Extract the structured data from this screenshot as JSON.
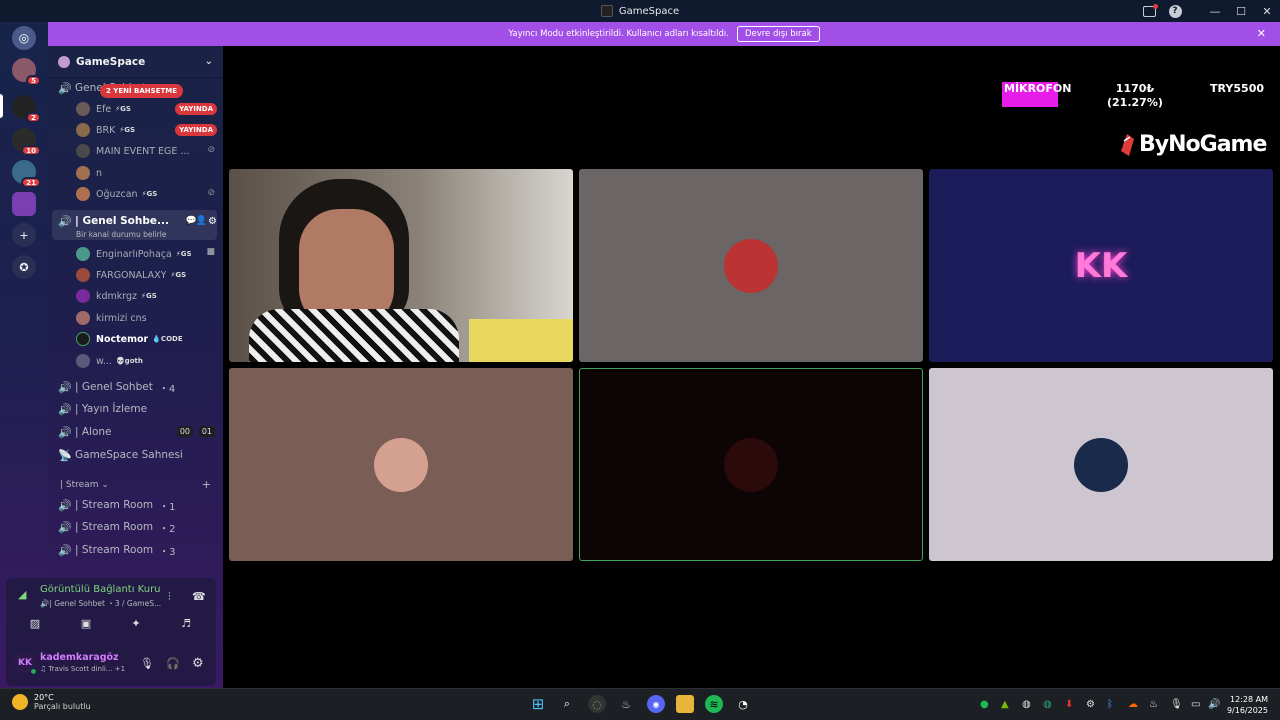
{
  "window": {
    "title": "GameSpace"
  },
  "banner": {
    "message": "Yayıncı Modu etkinleştirildi. Kullanıcı adları kısaltıldı.",
    "button": "Devre dışı bırak"
  },
  "guilds": [
    {
      "name": "guild-1",
      "badge": "5",
      "color": "#8a5a6a"
    },
    {
      "name": "guild-2",
      "badge": "2",
      "color": "#222"
    },
    {
      "name": "guild-3",
      "badge": "10",
      "color": "#2b2b2b"
    },
    {
      "name": "guild-4",
      "badge": "21",
      "color": "#3b6a8a"
    },
    {
      "name": "guild-5",
      "badge": "",
      "color": "#7a3fb0"
    }
  ],
  "server": {
    "name": "GameSpace"
  },
  "mention_pill": "2 YENİ BAHSETME",
  "channel_top": {
    "label": "Genel Sohbet",
    "count": "2"
  },
  "top_users": [
    {
      "name": "Efe",
      "tag": "⚡GS",
      "live": "YAYINDA",
      "av": "#6a5a5a"
    },
    {
      "name": "BRK",
      "tag": "⚡GS",
      "live": "YAYINDA",
      "av": "#8a6a4a"
    },
    {
      "name": "MAIN EVENT EGE ...",
      "tag": "",
      "live": "",
      "av": "#4a4a4a"
    },
    {
      "name": "n",
      "tag": "",
      "live": "",
      "av": "#a07050"
    },
    {
      "name": "Oğuzcan",
      "tag": "⚡GS",
      "live": "",
      "av": "#b07050"
    }
  ],
  "selected_channel": {
    "label": "| Genel Sohbe...",
    "status": "Bir kanal durumu belirle"
  },
  "sel_users": [
    {
      "name": "EnginarlıPohaça",
      "tag": "⚡GS",
      "av": "#4a9a8a"
    },
    {
      "name": "FARGONALAXY",
      "tag": "⚡GS",
      "av": "#9a4a3a"
    },
    {
      "name": "kdmkrgz",
      "tag": "⚡GS",
      "av": "#7a2a9a"
    },
    {
      "name": "kirmizi cns",
      "tag": "",
      "av": "#a06a6a"
    },
    {
      "name": "Noctemor",
      "tag": "💧CODE",
      "av": "#1a1a1a"
    },
    {
      "name": "w...",
      "tag": "💀goth",
      "av": "#5a5a7a"
    }
  ],
  "channels": [
    {
      "label": "| Genel Sohbet",
      "count": "4",
      "icon": "🔊"
    },
    {
      "label": "| Yayın İzleme",
      "count": "",
      "icon": "🔊"
    },
    {
      "label": "| Alone",
      "count": "",
      "icon": "🔊",
      "b1": "00",
      "b2": "01"
    },
    {
      "label": "GameSpace Sahnesi",
      "count": "",
      "icon": "📡"
    }
  ],
  "category": {
    "label": "| Stream"
  },
  "streams": [
    {
      "label": "| Stream Room",
      "count": "1"
    },
    {
      "label": "| Stream Room",
      "count": "2"
    },
    {
      "label": "| Stream Room",
      "count": "3"
    }
  ],
  "voice_panel": {
    "title": "Görüntülü Bağlantı Kuruldu",
    "subtitle": "🔊| Genel Sohbet  ・3 / GameS...",
    "user_name": "kademkaragöz",
    "user_initials": "KK",
    "user_status": "♫ Travis Scott dinli...   +1"
  },
  "overlay": {
    "mic_label": "MİKROFON",
    "amount_line1": "1170₺",
    "amount_line2": "(21.27%)",
    "goal": "TRY5500",
    "progress_percent": 21.27
  },
  "brand": "ByNoGame",
  "tiles": [
    {
      "name": "video-tile-webcam",
      "bg": "#3a3230"
    },
    {
      "name": "video-tile-2",
      "bg": "#6b6565",
      "av": "#b33"
    },
    {
      "name": "video-tile-kk",
      "bg": "#1c1c5a",
      "text": "KK"
    },
    {
      "name": "video-tile-4",
      "bg": "#7a5e55",
      "av": "#d4a090"
    },
    {
      "name": "video-tile-5",
      "bg": "#0d0505",
      "av": "#2a0a0a"
    },
    {
      "name": "video-tile-6",
      "bg": "#cdc5cf",
      "av": "#1a2a4a"
    }
  ],
  "taskbar": {
    "temp": "20°C",
    "weather_desc": "Parçalı bulutlu",
    "time": "12:28 AM",
    "date": "9/16/2025"
  }
}
